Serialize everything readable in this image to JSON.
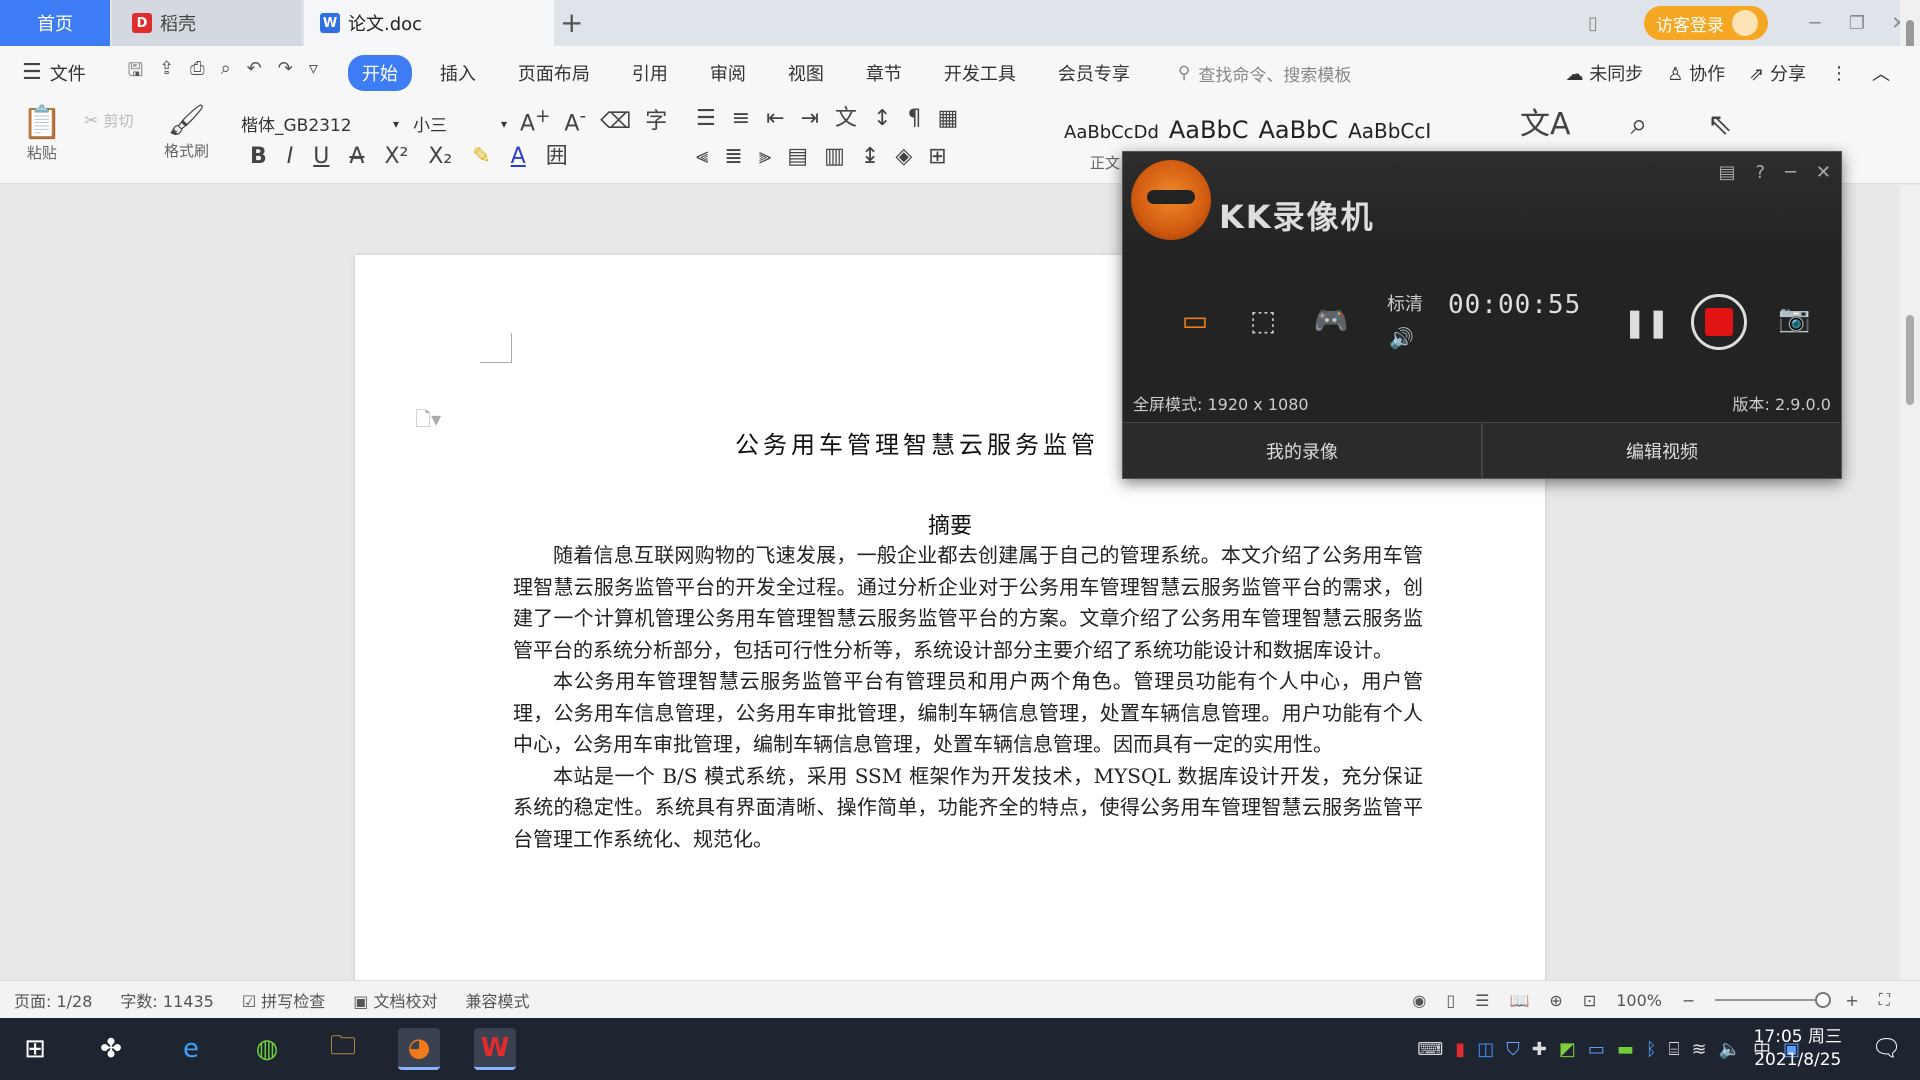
{
  "tabs": {
    "home": "首页",
    "daoke": "稻壳",
    "doc": "论文.doc",
    "add": "+"
  },
  "title_right": {
    "login": "访客登录"
  },
  "menu": {
    "file": "文件",
    "tabs": [
      "开始",
      "插入",
      "页面布局",
      "引用",
      "审阅",
      "视图",
      "章节",
      "开发工具",
      "会员专享"
    ],
    "search_placeholder": "查找命令、搜索模板",
    "sync": "未同步",
    "collab": "协作",
    "share": "分享"
  },
  "ribbon": {
    "paste": "粘贴",
    "cut": "剪切",
    "format_painter": "格式刷",
    "font_name": "楷体_GB2312",
    "font_size": "小三",
    "styles": [
      "AaBbCcDd",
      "AaBbC",
      "AaBbC",
      "AaBbCcI"
    ],
    "style_normal": "正文"
  },
  "document": {
    "title": "公务用车管理智慧云服务监管",
    "abstract_heading": "摘要",
    "paragraphs": [
      "随着信息互联网购物的飞速发展，一般企业都去创建属于自己的管理系统。本文介绍了公务用车管理智慧云服务监管平台的开发全过程。通过分析企业对于公务用车管理智慧云服务监管平台的需求，创建了一个计算机管理公务用车管理智慧云服务监管平台的方案。文章介绍了公务用车管理智慧云服务监管平台的系统分析部分，包括可行性分析等，系统设计部分主要介绍了系统功能设计和数据库设计。",
      "本公务用车管理智慧云服务监管平台有管理员和用户两个角色。管理员功能有个人中心，用户管理，公务用车信息管理，公务用车审批管理，编制车辆信息管理，处置车辆信息管理。用户功能有个人中心，公务用车审批管理，编制车辆信息管理，处置车辆信息管理。因而具有一定的实用性。",
      "本站是一个 B/S 模式系统，采用 SSM 框架作为开发技术，MYSQL 数据库设计开发，充分保证系统的稳定性。系统具有界面清晰、操作简单，功能齐全的特点，使得公务用车管理智慧云服务监管平台管理工作系统化、规范化。"
    ]
  },
  "status": {
    "page": "页面: 1/28",
    "words": "字数: 11435",
    "spell": "拼写检查",
    "proof": "文档校对",
    "compat": "兼容模式",
    "zoom": "100%"
  },
  "taskbar": {
    "time": "17:05 周三",
    "date": "2021/8/25",
    "ime": "中"
  },
  "recorder": {
    "brand": "KK录像机",
    "quality": "标清",
    "timer": "00:00:55",
    "mode": "全屏模式: 1920 x 1080",
    "version": "版本: 2.9.0.0",
    "my_videos": "我的录像",
    "edit_video": "编辑视频",
    "colors": {
      "stop": "#e01414",
      "mode_active": "#f07a1a",
      "logo": "#e06a1a"
    }
  },
  "colors": {
    "accent": "#3d7cf5",
    "login": "#f5a623",
    "daoke_icon": "#e02c2c",
    "doc_icon": "#2f6fe4"
  }
}
